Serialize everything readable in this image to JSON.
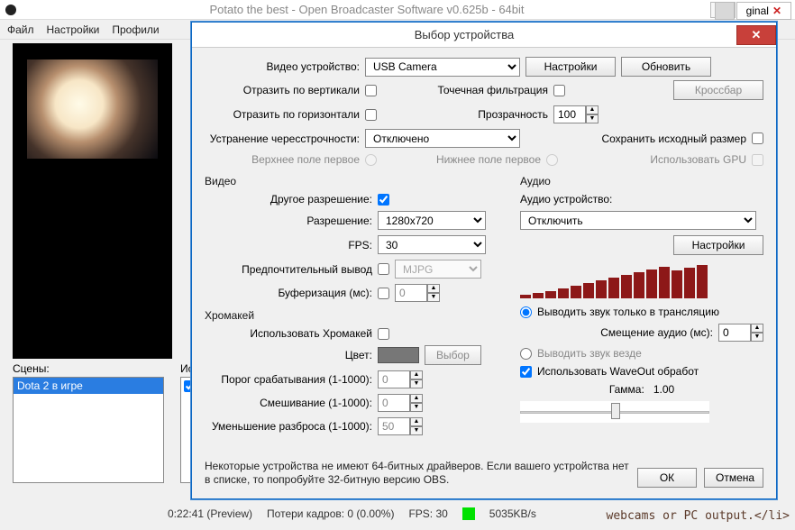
{
  "mainWindow": {
    "title": "Potato the best - Open Broadcaster Software v0.625b - 64bit",
    "menus": [
      "Файл",
      "Настройки",
      "Профили"
    ],
    "scenesLabel": "Сцены:",
    "sourcesLabel": "Источники:",
    "sceneItems": [
      "Dota 2 в игре"
    ]
  },
  "tabs": {
    "bg": "",
    "active": "ginal"
  },
  "statusbar": {
    "time": "0:22:41 (Preview)",
    "dropped": "Потери кадров: 0 (0.00%)",
    "fps": "FPS: 30",
    "bitrate": "5035KB/s"
  },
  "bgText": "webcams or PC output.</li>",
  "dialog": {
    "title": "Выбор устройства",
    "videoDeviceLabel": "Видео устройство:",
    "videoDevice": "USB Camera",
    "settingsBtn": "Настройки",
    "refreshBtn": "Обновить",
    "flipVLabel": "Отразить по вертикали",
    "pointFilterLabel": "Точечная фильтрация",
    "crossbarBtn": "Кроссбар",
    "flipHLabel": "Отразить по горизонтали",
    "opacityLabel": "Прозрачность",
    "opacityValue": "100",
    "deinterlaceLabel": "Устранение чересстрочности:",
    "deinterlaceValue": "Отключено",
    "preserveSizeLabel": "Сохранить исходный размер",
    "topFieldFirst": "Верхнее поле первое",
    "bottomFieldFirst": "Нижнее поле первое",
    "useGpuLabel": "Использовать GPU",
    "videoGroup": "Видео",
    "audioGroup": "Аудио",
    "customResLabel": "Другое разрешение:",
    "resolutionLabel": "Разрешение:",
    "resolutionValue": "1280x720",
    "fpsLabel": "FPS:",
    "fpsValue": "30",
    "preferredOutputLabel": "Предпочтительный вывод",
    "preferredOutputValue": "MJPG",
    "bufferingLabel": "Буферизация (мс):",
    "bufferingValue": "0",
    "chromaGroup": "Хромакей",
    "useChromaLabel": "Использовать Хромакей",
    "colorLabel": "Цвет:",
    "chooseBtn": "Выбор",
    "thresholdLabel": "Порог срабатывания (1-1000):",
    "thresholdValue": "0",
    "blendLabel": "Смешивание (1-1000):",
    "blendValue": "0",
    "spillLabel": "Уменьшение разброса (1-1000):",
    "spillValue": "50",
    "audioDeviceLabel": "Аудио устройство:",
    "audioDeviceValue": "Отключить",
    "audioSettingsBtn": "Настройки",
    "outputStreamOnly": "Выводить звук только в трансляцию",
    "audioOffsetLabel": "Смещение аудио (мс):",
    "audioOffsetValue": "0",
    "outputEverywhere": "Выводить звук везде",
    "useWaveOut": "Использовать WaveOut обработ",
    "gammaLabel": "Гамма:",
    "gammaValue": "1.00",
    "footerNote": "Некоторые устройства не имеют 64-битных драйверов. Если вашего устройства нет в списке, то попробуйте 32-битную версию OBS.",
    "okBtn": "ОК",
    "cancelBtn": "Отмена"
  }
}
